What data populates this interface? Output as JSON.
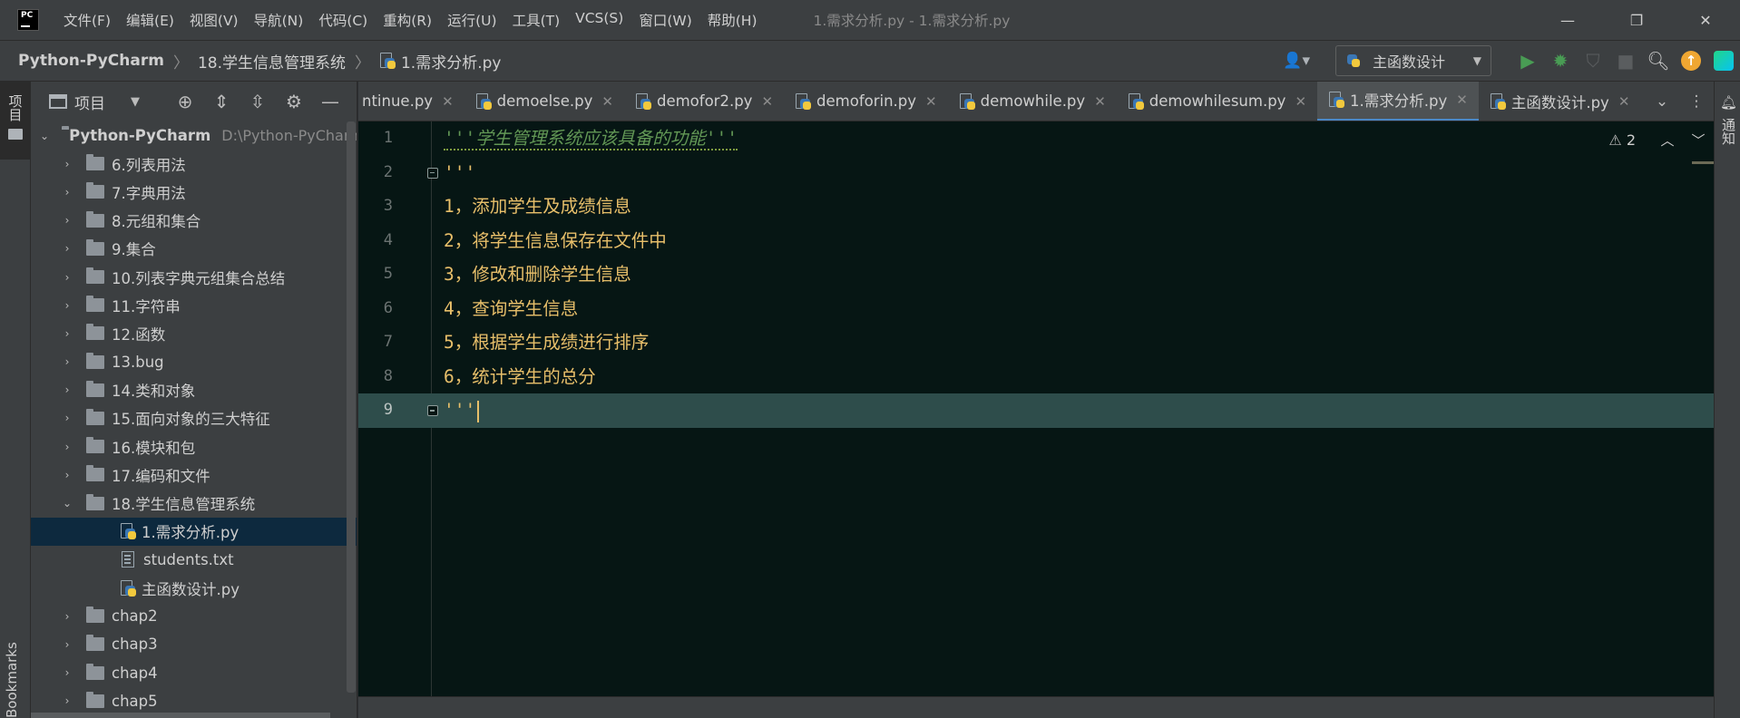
{
  "app": {
    "logo_text": "PC",
    "window_title": "1.需求分析.py - 1.需求分析.py"
  },
  "menu": [
    {
      "label": "文件(F)"
    },
    {
      "label": "编辑(E)"
    },
    {
      "label": "视图(V)"
    },
    {
      "label": "导航(N)"
    },
    {
      "label": "代码(C)"
    },
    {
      "label": "重构(R)"
    },
    {
      "label": "运行(U)"
    },
    {
      "label": "工具(T)"
    },
    {
      "label": "VCS(S)"
    },
    {
      "label": "窗口(W)"
    },
    {
      "label": "帮助(H)"
    }
  ],
  "window_controls": {
    "minimize": "—",
    "restore": "❐",
    "close": "✕"
  },
  "breadcrumb": {
    "project": "Python-PyCharm",
    "folder": "18.学生信息管理系统",
    "file": "1.需求分析.py"
  },
  "toolbar": {
    "run_config": "主函数设计",
    "icons": [
      "user-icon",
      "run-icon",
      "debug-icon",
      "coverage-icon",
      "stop-icon",
      "search-icon",
      "update-icon",
      "jetbrains-icon"
    ]
  },
  "left_stripe": {
    "project_label": "项目",
    "bookmarks_label": "Bookmarks"
  },
  "project_panel": {
    "title": "项目",
    "tree": [
      {
        "label": "Python-PyCharm",
        "path": "D:\\Python-PyCharm",
        "type": "root",
        "expanded": true
      },
      {
        "label": "6.列表用法",
        "type": "folder"
      },
      {
        "label": "7.字典用法",
        "type": "folder"
      },
      {
        "label": "8.元组和集合",
        "type": "folder"
      },
      {
        "label": "9.集合",
        "type": "folder"
      },
      {
        "label": "10.列表字典元组集合总结",
        "type": "folder"
      },
      {
        "label": "11.字符串",
        "type": "folder"
      },
      {
        "label": "12.函数",
        "type": "folder"
      },
      {
        "label": "13.bug",
        "type": "folder"
      },
      {
        "label": "14.类和对象",
        "type": "folder"
      },
      {
        "label": "15.面向对象的三大特征",
        "type": "folder"
      },
      {
        "label": "16.模块和包",
        "type": "folder"
      },
      {
        "label": "17.编码和文件",
        "type": "folder"
      },
      {
        "label": "18.学生信息管理系统",
        "type": "folder",
        "expanded": true
      },
      {
        "label": "1.需求分析.py",
        "type": "py",
        "selected": true
      },
      {
        "label": "students.txt",
        "type": "txt"
      },
      {
        "label": "主函数设计.py",
        "type": "py"
      },
      {
        "label": "chap2",
        "type": "folder"
      },
      {
        "label": "chap3",
        "type": "folder"
      },
      {
        "label": "chap4",
        "type": "folder"
      },
      {
        "label": "chap5",
        "type": "folder"
      }
    ]
  },
  "tabs": [
    {
      "label": "ntinue.py",
      "active": false
    },
    {
      "label": "demoelse.py",
      "active": false
    },
    {
      "label": "demofor2.py",
      "active": false
    },
    {
      "label": "demoforin.py",
      "active": false
    },
    {
      "label": "demowhile.py",
      "active": false
    },
    {
      "label": "demowhilesum.py",
      "active": false
    },
    {
      "label": "1.需求分析.py",
      "active": true
    },
    {
      "label": "主函数设计.py",
      "active": false
    }
  ],
  "right_stripe": {
    "notifications_label": "通知"
  },
  "editor": {
    "warnings": "2",
    "lines": [
      {
        "num": "1",
        "text": "'''学生管理系统应该具备的功能'''",
        "kind": "doc"
      },
      {
        "num": "2",
        "text": "'''",
        "kind": "str",
        "fold": true
      },
      {
        "num": "3",
        "text": "1，添加学生及成绩信息",
        "kind": "str"
      },
      {
        "num": "4",
        "text": "2，将学生信息保存在文件中",
        "kind": "str"
      },
      {
        "num": "5",
        "text": "3，修改和删除学生信息",
        "kind": "str"
      },
      {
        "num": "6",
        "text": "4，查询学生信息",
        "kind": "str"
      },
      {
        "num": "7",
        "text": "5，根据学生成绩进行排序",
        "kind": "str"
      },
      {
        "num": "8",
        "text": "6，统计学生的总分",
        "kind": "str"
      },
      {
        "num": "9",
        "text": "'''",
        "kind": "str",
        "fold": true,
        "current": true
      }
    ]
  },
  "colors": {
    "accent": "#4a88c7",
    "string": "#e8bf6a",
    "doc_comment": "#629755",
    "editor_bg": "#061614",
    "current_line": "#2e4d4b"
  }
}
